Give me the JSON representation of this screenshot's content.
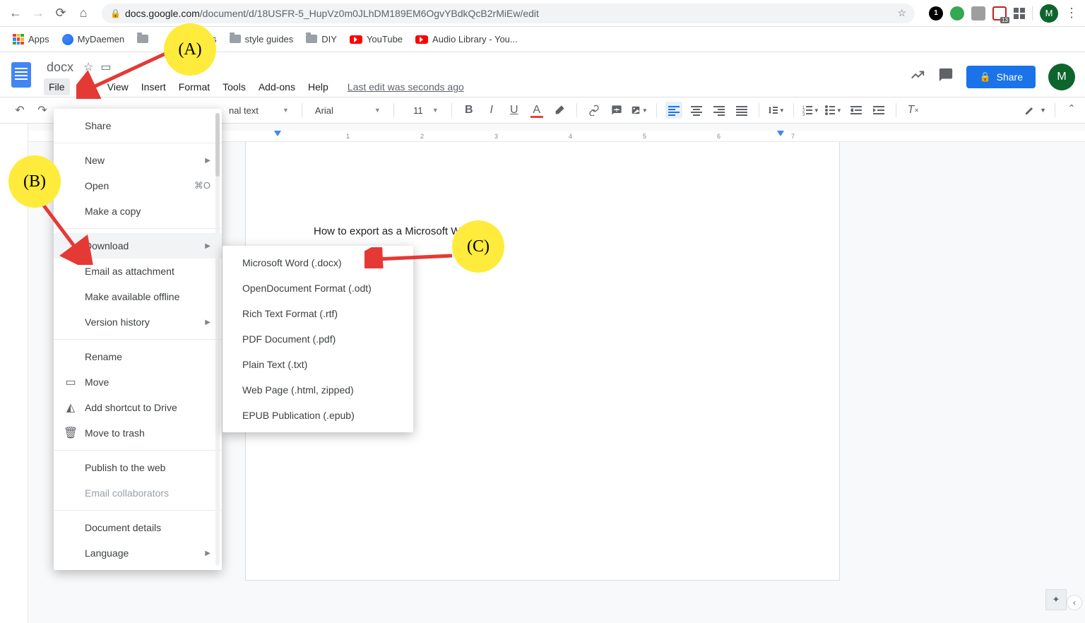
{
  "browser": {
    "url_domain": "docs.google.com",
    "url_path": "/document/d/18USFR-5_HupVz0m0JLhDM189EM6OgvYBdkQcB2rMiEw/edit",
    "ext_badge_count": "13",
    "avatar_letter": "M"
  },
  "bookmarks": {
    "apps": "Apps",
    "items": [
      "MyDaemen",
      "News",
      "style guides",
      "DIY",
      "YouTube",
      "Audio Library - You..."
    ]
  },
  "docs": {
    "title": "docx",
    "menus": [
      "File",
      "Edit",
      "View",
      "Insert",
      "Format",
      "Tools",
      "Add-ons",
      "Help"
    ],
    "last_edit": "Last edit was seconds ago",
    "share_label": "Share",
    "avatar_letter": "M"
  },
  "toolbar": {
    "style_label": "nal text",
    "font_label": "Arial",
    "font_size": "11"
  },
  "document_body": "How to export as a Microsoft Word f",
  "file_menu": {
    "share": "Share",
    "new": "New",
    "open": "Open",
    "open_shortcut": "⌘O",
    "make_copy": "Make a copy",
    "download": "Download",
    "email_attach": "Email as attachment",
    "make_offline": "Make available offline",
    "version_history": "Version history",
    "rename": "Rename",
    "move": "Move",
    "add_shortcut": "Add shortcut to Drive",
    "move_trash": "Move to trash",
    "publish": "Publish to the web",
    "email_collab": "Email collaborators",
    "doc_details": "Document details",
    "language": "Language"
  },
  "download_submenu": {
    "items": [
      "Microsoft Word (.docx)",
      "OpenDocument Format (.odt)",
      "Rich Text Format (.rtf)",
      "PDF Document (.pdf)",
      "Plain Text (.txt)",
      "Web Page (.html, zipped)",
      "EPUB Publication (.epub)"
    ]
  },
  "ruler_numbers": [
    "1",
    "2",
    "3",
    "4",
    "5",
    "6",
    "7"
  ],
  "annotations": {
    "a": "(A)",
    "b": "(B)",
    "c": "(C)"
  }
}
